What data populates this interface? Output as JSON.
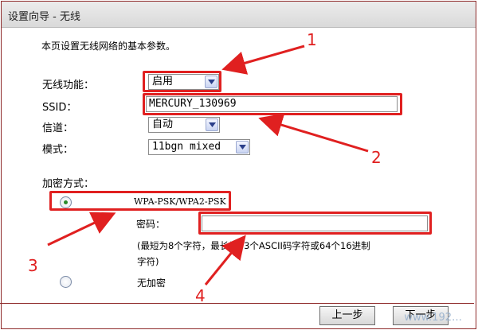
{
  "titlebar": {
    "title": "设置向导 - 无线"
  },
  "intro": "本页设置无线网络的基本参数。",
  "fields": {
    "wireless_label": "无线功能：",
    "wireless_value": "启用",
    "ssid_label": "SSID：",
    "ssid_value": "MERCURY_130969",
    "channel_label": "信道：",
    "channel_value": "自动",
    "mode_label": "模式：",
    "mode_value": "11bgn mixed"
  },
  "encryption": {
    "label": "加密方式：",
    "wpa_option": "WPA-PSK/WPA2-PSK",
    "password_label": "密码：",
    "password_value": "",
    "hint_line1": "(最短为8个字符，最长为63个ASCII码字符或64个16进制",
    "hint_line2": "字符)",
    "none_option": "无加密"
  },
  "annotations": [
    "1",
    "2",
    "3",
    "4"
  ],
  "buttons": {
    "back": "上一步",
    "next": "下一步"
  },
  "watermark": "www.192…",
  "colors": {
    "annotation_red": "#e02020",
    "frame": "#8e2a2a",
    "radio_selected": "#2a8a2a"
  }
}
